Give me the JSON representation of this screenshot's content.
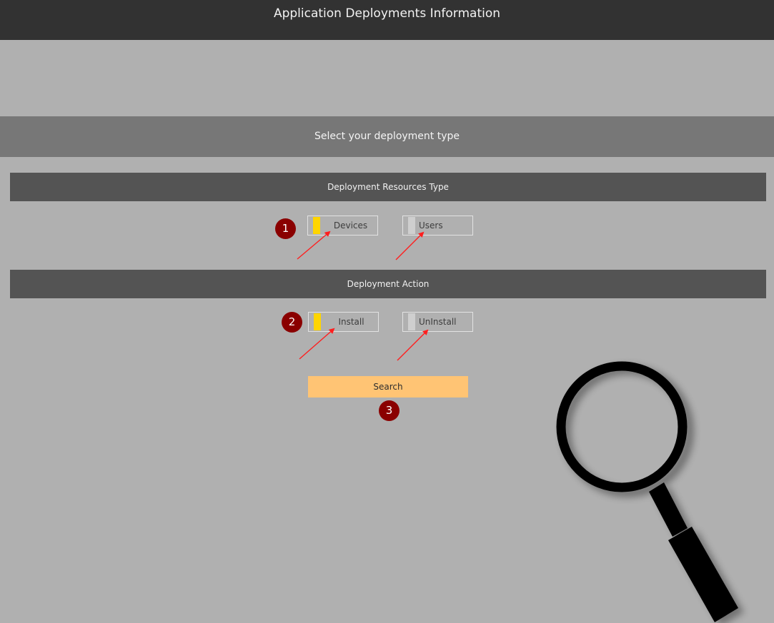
{
  "header": {
    "title": "Application Deployments Information"
  },
  "banner": {
    "text": "Select your deployment type"
  },
  "resources_section": {
    "title": "Deployment Resources Type",
    "options": [
      {
        "label": "Devices",
        "selected": true
      },
      {
        "label": "Users",
        "selected": false
      }
    ],
    "step": "1"
  },
  "action_section": {
    "title": "Deployment Action",
    "options": [
      {
        "label": "Install",
        "selected": true
      },
      {
        "label": "UnInstall",
        "selected": false
      }
    ],
    "step": "2"
  },
  "search": {
    "label": "Search",
    "step": "3"
  },
  "colors": {
    "header_bg": "#323232",
    "page_bg": "#b0b0b0",
    "banner_bg": "#777777",
    "section_bg": "#545454",
    "selected_indicator": "#ffd500",
    "search_bg": "#ffc474",
    "badge_bg": "#8a0000",
    "arrow": "#ff1e1e"
  },
  "icons": {
    "decoration": "magnifying-glass-icon",
    "annotation": "arrow-icon"
  }
}
